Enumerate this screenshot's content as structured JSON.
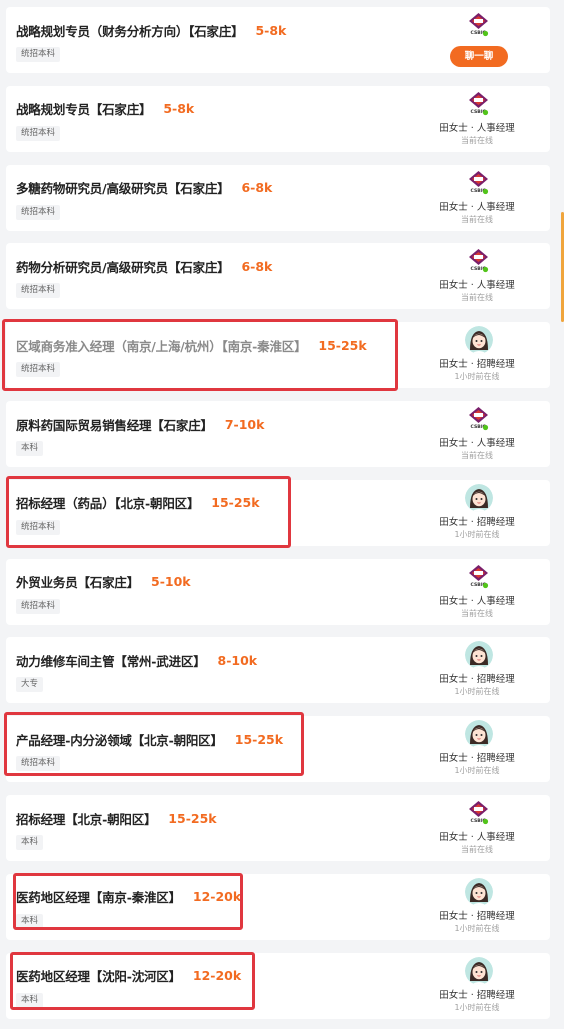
{
  "jobs": [
    {
      "title": "战略规划专员（财务分析方向）【石家庄】",
      "salary": "5-8k",
      "edu": "统招本科",
      "recruiter": "",
      "status": "",
      "chat_label": "聊一聊",
      "avatar": "company-logo",
      "visited": false,
      "highlighted": false
    },
    {
      "title": "战略规划专员【石家庄】",
      "salary": "5-8k",
      "edu": "统招本科",
      "recruiter": "田女士 · 人事经理",
      "status": "当前在线",
      "avatar": "company-logo",
      "visited": false,
      "highlighted": false
    },
    {
      "title": "多糖药物研究员/高级研究员【石家庄】",
      "salary": "6-8k",
      "edu": "统招本科",
      "recruiter": "田女士 · 人事经理",
      "status": "当前在线",
      "avatar": "company-logo",
      "visited": false,
      "highlighted": false
    },
    {
      "title": "药物分析研究员/高级研究员【石家庄】",
      "salary": "6-8k",
      "edu": "统招本科",
      "recruiter": "田女士 · 人事经理",
      "status": "当前在线",
      "avatar": "company-logo",
      "visited": false,
      "highlighted": false
    },
    {
      "title": "区域商务准入经理（南京/上海/杭州）【南京-秦淮区】",
      "salary": "15-25k",
      "edu": "统招本科",
      "recruiter": "田女士 · 招聘经理",
      "status": "1小时前在线",
      "avatar": "cartoon-avatar",
      "visited": true,
      "highlighted": true
    },
    {
      "title": "原料药国际贸易销售经理【石家庄】",
      "salary": "7-10k",
      "edu": "本科",
      "recruiter": "田女士 · 人事经理",
      "status": "当前在线",
      "avatar": "company-logo",
      "visited": false,
      "highlighted": false
    },
    {
      "title": "招标经理（药品）【北京-朝阳区】",
      "salary": "15-25k",
      "edu": "统招本科",
      "recruiter": "田女士 · 招聘经理",
      "status": "1小时前在线",
      "avatar": "cartoon-avatar",
      "visited": false,
      "highlighted": true
    },
    {
      "title": "外贸业务员【石家庄】",
      "salary": "5-10k",
      "edu": "统招本科",
      "recruiter": "田女士 · 人事经理",
      "status": "当前在线",
      "avatar": "company-logo",
      "visited": false,
      "highlighted": false
    },
    {
      "title": "动力维修车间主管【常州-武进区】",
      "salary": "8-10k",
      "edu": "大专",
      "recruiter": "田女士 · 招聘经理",
      "status": "1小时前在线",
      "avatar": "cartoon-avatar",
      "visited": false,
      "highlighted": false
    },
    {
      "title": "产品经理-内分泌领域【北京-朝阳区】",
      "salary": "15-25k",
      "edu": "统招本科",
      "recruiter": "田女士 · 招聘经理",
      "status": "1小时前在线",
      "avatar": "cartoon-avatar",
      "visited": false,
      "highlighted": true
    },
    {
      "title": "招标经理【北京-朝阳区】",
      "salary": "15-25k",
      "edu": "本科",
      "recruiter": "田女士 · 人事经理",
      "status": "当前在线",
      "avatar": "company-logo",
      "visited": false,
      "highlighted": false
    },
    {
      "title": "医药地区经理【南京-秦淮区】",
      "salary": "12-20k",
      "edu": "本科",
      "recruiter": "田女士 · 招聘经理",
      "status": "1小时前在线",
      "avatar": "cartoon-avatar",
      "visited": false,
      "highlighted": true
    },
    {
      "title": "医药地区经理【沈阳-沈河区】",
      "salary": "12-20k",
      "edu": "本科",
      "recruiter": "田女士 · 招聘经理",
      "status": "1小时前在线",
      "avatar": "cartoon-avatar",
      "visited": false,
      "highlighted": true
    }
  ],
  "company_logo_text": "CSBIO",
  "colors": {
    "salary": "#f26b21",
    "highlight": "#e0373f",
    "online_dot": "#52c41a"
  }
}
